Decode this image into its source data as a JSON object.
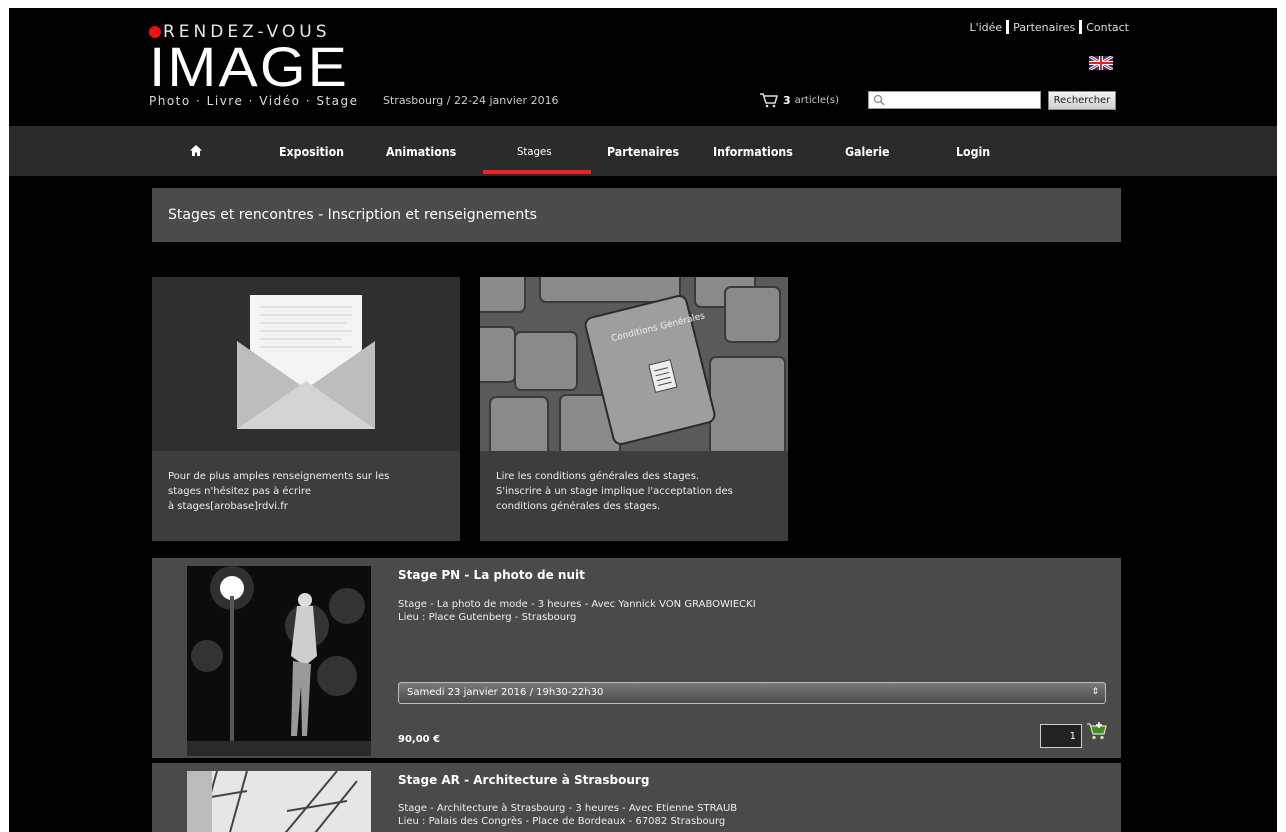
{
  "header": {
    "logo_top": "RENDEZ-VOUS",
    "logo_main": "IMAGE",
    "logo_sub": "Photo · Livre · Vidéo · Stage",
    "event_date": "Strasbourg / 22-24 janvier 2016",
    "links": [
      "L'idée",
      "Partenaires",
      "Contact"
    ],
    "cart_count": "3",
    "cart_label": "article(s)",
    "search_placeholder": "",
    "search_button": "Rechercher"
  },
  "nav": {
    "home_icon": "home-icon",
    "items": [
      "Exposition",
      "Animations",
      "Stages",
      "Partenaires",
      "Informations",
      "Galerie",
      "Login"
    ],
    "active": "Stages",
    "accent_color": "#e22222"
  },
  "page_title": "Stages et rencontres - Inscription et renseignements",
  "cards": [
    {
      "image": "envelope-letter-image",
      "lines": [
        "Pour de plus amples renseignements sur les",
        "stages n'hésitez pas à écrire",
        "à stages[arobase]rdvi.fr"
      ]
    },
    {
      "image": "keyboard-conditions-generales-image",
      "key_label": "Conditions Générales",
      "lines": [
        "Lire les conditions générales des stages.",
        "S'inscrire à un stage implique l'acceptation des",
        "conditions générales des stages."
      ]
    }
  ],
  "stages": [
    {
      "title": "Stage PN - La photo de nuit",
      "desc1": "Stage - La photo de mode - 3 heures - Avec Yannick VON GRABOWIECKI",
      "desc2": "Lieu : Place Gutenberg - Strasbourg",
      "session": "Samedi 23 janvier 2016 / 19h30-22h30",
      "price": "90,00 €",
      "qty": "1"
    },
    {
      "title": "Stage AR - Architecture à Strasbourg",
      "desc1": "Stage - Architecture à Strasbourg - 3 heures - Avec Etienne STRAUB",
      "desc2": "Lieu : Palais des Congrès - Place de Bordeaux - 67082 Strasbourg"
    }
  ]
}
